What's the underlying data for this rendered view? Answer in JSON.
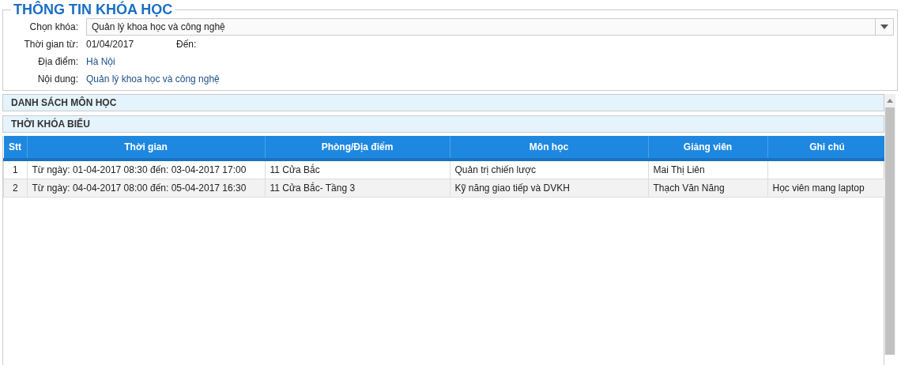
{
  "course_info": {
    "title": "THÔNG TIN KHÓA HỌC",
    "select_label": "Chọn khóa:",
    "select_value": "Quản lý khoa học và công nghệ",
    "time_label": "Thời gian từ:",
    "time_from": "01/04/2017",
    "to_label": "Đến:",
    "place_label": "Địa điểm:",
    "place": "Hà Nội",
    "content_label": "Nội dung:",
    "content": "Quản lý khoa học và công nghệ"
  },
  "panels": [
    {
      "title": "DANH SÁCH MÔN HỌC"
    },
    {
      "title": "THỜI KHÓA BIỂU"
    }
  ],
  "table": {
    "columns": [
      "Stt",
      "Thời gian",
      "Phòng/Địa điểm",
      "Môn học",
      "Giảng viên",
      "Ghi chú"
    ],
    "rows": [
      [
        "1",
        "Từ ngày: 01-04-2017 08:30 đến: 03-04-2017 17:00",
        "11 Cửa Bắc",
        "Quản trị chiến lược",
        "Mai Thị Liên",
        ""
      ],
      [
        "2",
        "Từ ngày: 04-04-2017 08:00 đến: 05-04-2017 16:30",
        "11 Cửa Bắc- Tầng 3",
        "Kỹ năng giao tiếp và DVKH",
        "Thạch Văn Năng",
        "Học viên mang laptop"
      ]
    ]
  }
}
